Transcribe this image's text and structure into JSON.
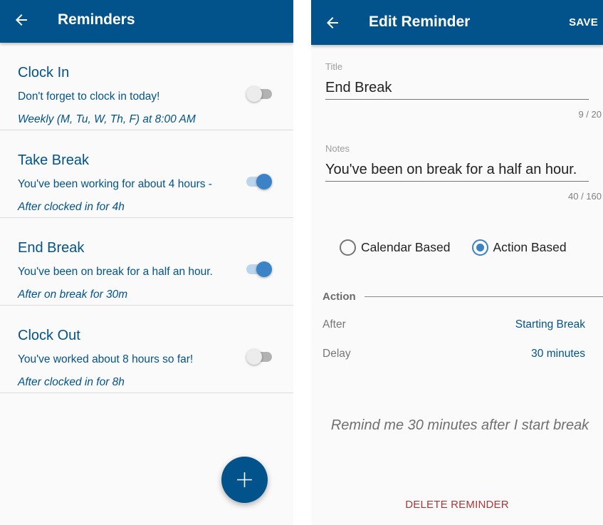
{
  "list_screen": {
    "title": "Reminders",
    "back_icon": "arrow-left-icon",
    "reminders": [
      {
        "title": "Clock In",
        "notes": "Don't forget to clock in today!",
        "schedule": "Weekly (M, Tu, W, Th, F) at 8:00 AM",
        "enabled": false
      },
      {
        "title": "Take Break",
        "notes": "You've been working for about 4 hours -",
        "schedule": "After clocked in for 4h",
        "enabled": true
      },
      {
        "title": "End Break",
        "notes": "You've been on break for a half an hour.",
        "schedule": "After on break for 30m",
        "enabled": true
      },
      {
        "title": "Clock Out",
        "notes": "You've worked about 8 hours so far!",
        "schedule": "After clocked in for 8h",
        "enabled": false
      }
    ],
    "fab_icon": "plus-icon"
  },
  "edit_screen": {
    "title": "Edit Reminder",
    "back_icon": "arrow-left-icon",
    "save_label": "SAVE",
    "title_field": {
      "label": "Title",
      "value": "End Break",
      "counter": "9 / 20"
    },
    "notes_field": {
      "label": "Notes",
      "value": "You've been on break for a half an hour.",
      "counter": "40 / 160"
    },
    "mode_options": [
      {
        "label": "Calendar Based",
        "checked": false
      },
      {
        "label": "Action Based",
        "checked": true
      }
    ],
    "action_section": {
      "title": "Action",
      "after_label": "After",
      "after_value": "Starting Break",
      "delay_label": "Delay",
      "delay_value": "30 minutes"
    },
    "summary": "Remind me 30 minutes after I start break",
    "delete_label": "DELETE REMINDER"
  },
  "colors": {
    "primary": "#02538b",
    "accent": "#3b82c6",
    "danger": "#a93737"
  }
}
